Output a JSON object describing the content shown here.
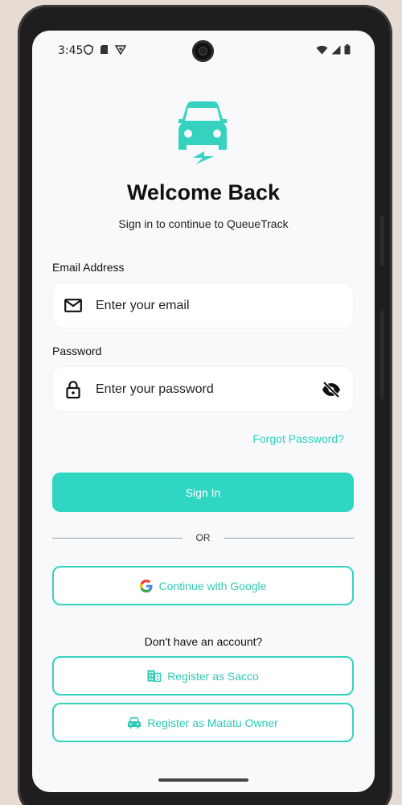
{
  "status_bar": {
    "time": "3:45",
    "icons": [
      "shield-icon",
      "sd-card-icon",
      "vpn-icon"
    ],
    "right_icons": [
      "wifi-icon",
      "cellular-signal-icon",
      "battery-icon"
    ]
  },
  "brand": {
    "accent": "#2fd6c2",
    "logo_icon": "car-charging-icon"
  },
  "header": {
    "title": "Welcome Back",
    "subtitle": "Sign in to continue to QueueTrack"
  },
  "form": {
    "email": {
      "label": "Email Address",
      "placeholder": "Enter your email",
      "value": "",
      "icon": "mail-icon"
    },
    "password": {
      "label": "Password",
      "placeholder": "Enter your password",
      "value": "",
      "icon": "lock-icon",
      "toggle_icon": "eye-off-icon"
    },
    "forgot_label": "Forgot Password?",
    "submit_label": "Sign In"
  },
  "divider": {
    "label": "OR"
  },
  "social": {
    "google_label": "Continue with Google",
    "icon": "google-icon"
  },
  "register": {
    "prompt": "Don't have an account?",
    "sacco_label": "Register as Sacco",
    "sacco_icon": "building-icon",
    "owner_label": "Register as Matatu Owner",
    "owner_icon": "car-icon"
  }
}
